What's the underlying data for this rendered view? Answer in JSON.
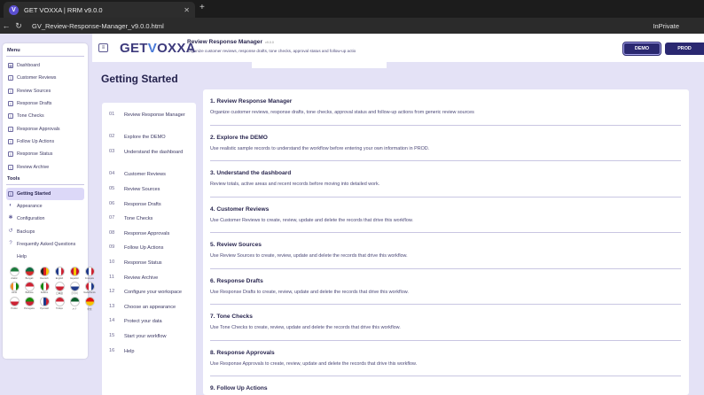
{
  "browser": {
    "tab_title": "GET VOXXA | RRM v9.0.0",
    "tab_favicon": "V",
    "url": "GV_Review-Response-Manager_v9.0.0.html",
    "inprivate": "InPrivate"
  },
  "sidebar": {
    "menu_title": "Menu",
    "menu_items": [
      {
        "label": "Dashboard",
        "icon": "grid-icon"
      },
      {
        "label": "Customer Reviews",
        "icon": "list-icon"
      },
      {
        "label": "Review Sources",
        "icon": "list-icon"
      },
      {
        "label": "Response Drafts",
        "icon": "list-icon"
      },
      {
        "label": "Tone Checks",
        "icon": "list-icon"
      },
      {
        "label": "Response Approvals",
        "icon": "list-icon"
      },
      {
        "label": "Follow Up Actions",
        "icon": "list-icon"
      },
      {
        "label": "Response Status",
        "icon": "list-icon"
      },
      {
        "label": "Review Archive",
        "icon": "list-icon"
      }
    ],
    "tools_title": "Tools",
    "tools_items": [
      {
        "label": "Getting Started",
        "icon": "list-icon",
        "active": true
      },
      {
        "label": "Appearance",
        "icon": "palette-icon"
      },
      {
        "label": "Configuration",
        "icon": "gear-icon"
      },
      {
        "label": "Backups",
        "icon": "backup-icon"
      },
      {
        "label": "Frequently Asked Questions",
        "icon": "help-icon"
      },
      {
        "label": "Help",
        "icon": "none"
      }
    ],
    "flags": [
      {
        "label": "Arabic",
        "colors": [
          "#1a7a3a",
          "#ffffff"
        ]
      },
      {
        "label": "Bengali",
        "colors": [
          "#0a6b3e",
          "#d72b2b"
        ]
      },
      {
        "label": "Deutsch",
        "colors": [
          "#222222",
          "#dd2222",
          "#f5c400"
        ]
      },
      {
        "label": "English",
        "colors": [
          "#1f3a8a",
          "#ffffff",
          "#cc2233"
        ]
      },
      {
        "label": "Español",
        "colors": [
          "#c8102e",
          "#f5c400",
          "#c8102e"
        ]
      },
      {
        "label": "Français",
        "colors": [
          "#1f3a8a",
          "#ffffff",
          "#cc2233"
        ]
      },
      {
        "label": "Hindi",
        "colors": [
          "#f28c28",
          "#ffffff",
          "#138808"
        ]
      },
      {
        "label": "Bahasa",
        "colors": [
          "#cc2233",
          "#ffffff"
        ]
      },
      {
        "label": "Italiano",
        "colors": [
          "#138808",
          "#ffffff",
          "#cc2233"
        ]
      },
      {
        "label": "日本語",
        "colors": [
          "#ffffff",
          "#cc2233"
        ]
      },
      {
        "label": "한국어",
        "colors": [
          "#ffffff",
          "#1f3a8a"
        ]
      },
      {
        "label": "Nederlands",
        "colors": [
          "#cc2233",
          "#ffffff",
          "#1f3a8a"
        ]
      },
      {
        "label": "Polski",
        "colors": [
          "#ffffff",
          "#cc2233"
        ]
      },
      {
        "label": "Português",
        "colors": [
          "#138808",
          "#cc2233"
        ]
      },
      {
        "label": "Русский",
        "colors": [
          "#ffffff",
          "#1f3a8a",
          "#cc2233"
        ]
      },
      {
        "label": "Türkçe",
        "colors": [
          "#cc2233",
          "#ffffff"
        ]
      },
      {
        "label": "اردو",
        "colors": [
          "#0a5d2a",
          "#ffffff"
        ]
      },
      {
        "label": "中文",
        "colors": [
          "#dd1111",
          "#f5c400"
        ]
      }
    ]
  },
  "header": {
    "logo_a": "GET",
    "logo_b": "V",
    "logo_c": "OXXA",
    "title": "Review Response Manager",
    "version": "v9.0.0",
    "subtitle": "Organize customer reviews, response drafts, tone checks, approval status and follow-up actio",
    "env_demo": "DEMO",
    "env_prod": "PROD"
  },
  "page": {
    "title": "Getting Started"
  },
  "toc": [
    {
      "num": "01",
      "label": "Review Response Manager"
    },
    {
      "num": "02",
      "label": "Explore the DEMO"
    },
    {
      "num": "03",
      "label": "Understand the dashboard"
    },
    {
      "num": "04",
      "label": "Customer Reviews"
    },
    {
      "num": "05",
      "label": "Review Sources"
    },
    {
      "num": "06",
      "label": "Response Drafts"
    },
    {
      "num": "07",
      "label": "Tone Checks"
    },
    {
      "num": "08",
      "label": "Response Approvals"
    },
    {
      "num": "09",
      "label": "Follow Up Actions"
    },
    {
      "num": "10",
      "label": "Response Status"
    },
    {
      "num": "11",
      "label": "Review Archive"
    },
    {
      "num": "12",
      "label": "Configure your workspace"
    },
    {
      "num": "13",
      "label": "Choose an appearance"
    },
    {
      "num": "14",
      "label": "Protect your data"
    },
    {
      "num": "15",
      "label": "Start your workflow"
    },
    {
      "num": "16",
      "label": "Help"
    }
  ],
  "sections": [
    {
      "title": "1. Review Response Manager",
      "body": "Organize customer reviews, response drafts, tone checks, approval status and follow-up actions from generic review sources"
    },
    {
      "title": "2. Explore the DEMO",
      "body": "Use realistic sample records to understand the workflow before entering your own information in PROD."
    },
    {
      "title": "3. Understand the dashboard",
      "body": "Review totals, active areas and recent records before moving into detailed work."
    },
    {
      "title": "4. Customer Reviews",
      "body": "Use Customer Reviews to create, review, update and delete the records that drive this workflow."
    },
    {
      "title": "5. Review Sources",
      "body": "Use Review Sources to create, review, update and delete the records that drive this workflow."
    },
    {
      "title": "6. Response Drafts",
      "body": "Use Response Drafts to create, review, update and delete the records that drive this workflow."
    },
    {
      "title": "7. Tone Checks",
      "body": "Use Tone Checks to create, review, update and delete the records that drive this workflow."
    },
    {
      "title": "8. Response Approvals",
      "body": "Use Response Approvals to create, review, update and delete the records that drive this workflow."
    },
    {
      "title": "9. Follow Up Actions",
      "body": ""
    }
  ]
}
